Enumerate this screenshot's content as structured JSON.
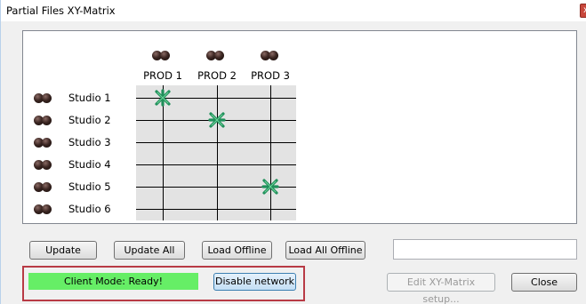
{
  "window": {
    "title": "Partial Files XY-Matrix",
    "close_glyph": "x"
  },
  "matrix": {
    "columns": [
      "PROD 1",
      "PROD 2",
      "PROD 3"
    ],
    "rows": [
      "Studio 1",
      "Studio 2",
      "Studio 3",
      "Studio 4",
      "Studio 5",
      "Studio 6"
    ],
    "connections": [
      {
        "row": "Studio 1",
        "column": "PROD 1"
      },
      {
        "row": "Studio 2",
        "column": "PROD 2"
      },
      {
        "row": "Studio 5",
        "column": "PROD 3"
      }
    ],
    "connection_icon": "green-asterisk-icon",
    "node_icon": "dual-dot-icon"
  },
  "buttons": {
    "update": "Update",
    "update_all": "Update All",
    "load_offline": "Load Offline",
    "load_all_offline": "Load All Offline",
    "edit_setup": "Edit XY-Matrix setup...",
    "close": "Close",
    "disable_network": "Disable network"
  },
  "status": {
    "text": "Client Mode: Ready!",
    "color": "#66ee66"
  },
  "highlight_color": "#b83a45"
}
